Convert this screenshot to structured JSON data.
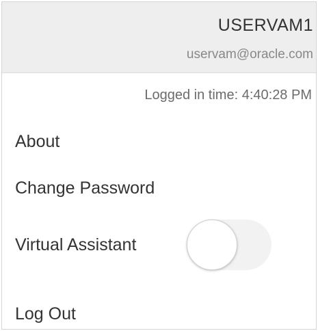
{
  "user": {
    "name": "USERVAM1",
    "email": "uservam@oracle.com",
    "logged_in_time": "Logged in time: 4:40:28 PM"
  },
  "menu": {
    "about": "About",
    "change_password": "Change Password",
    "virtual_assistant": {
      "label": "Virtual Assistant",
      "enabled": false
    },
    "log_out": "Log Out"
  },
  "colors": {
    "header_bg": "#eeeeee",
    "text": "#333333",
    "muted_text": "#888888",
    "toggle_track": "#f2f2f2"
  }
}
